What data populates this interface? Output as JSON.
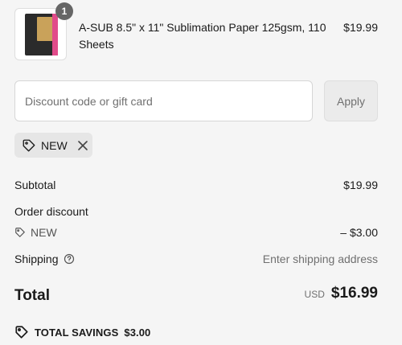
{
  "line_item": {
    "quantity": "1",
    "title": "A-SUB 8.5\" x 11\" Sublimation Paper 125gsm, 110 Sheets",
    "price": "$19.99"
  },
  "discount": {
    "placeholder": "Discount code or gift card",
    "apply_label": "Apply",
    "applied_code": "NEW"
  },
  "summary": {
    "subtotal_label": "Subtotal",
    "subtotal_value": "$19.99",
    "order_discount_label": "Order discount",
    "discount_code": "NEW",
    "discount_value": "– $3.00",
    "shipping_label": "Shipping",
    "shipping_value": "Enter shipping address",
    "total_label": "Total",
    "currency": "USD",
    "total_value": "$16.99",
    "savings_label": "TOTAL SAVINGS",
    "savings_value": "$3.00"
  },
  "icons": {
    "tag": "tag-icon",
    "close": "close-icon",
    "help": "question-circle-icon"
  },
  "colors": {
    "background": "#f5f5f5",
    "chip_background": "#e6e6e6",
    "badge": "#666666",
    "muted_text": "#707070"
  }
}
